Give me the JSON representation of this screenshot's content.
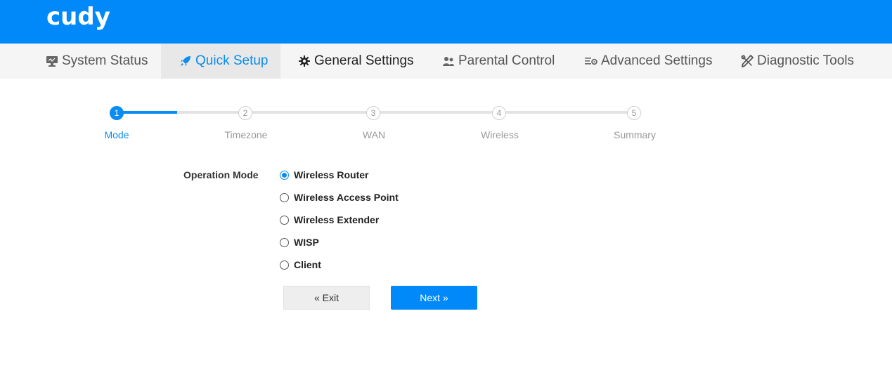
{
  "header": {
    "logo": "cudy",
    "brand_color": "#0189fa"
  },
  "nav": {
    "tabs": [
      {
        "label": "System Status",
        "icon": "monitor-icon"
      },
      {
        "label": "Quick Setup",
        "icon": "rocket-icon",
        "active": true
      },
      {
        "label": "General Settings",
        "icon": "gear-icon"
      },
      {
        "label": "Parental Control",
        "icon": "users-icon"
      },
      {
        "label": "Advanced Settings",
        "icon": "list-gear-icon"
      },
      {
        "label": "Diagnostic Tools",
        "icon": "tools-icon"
      }
    ]
  },
  "stepper": {
    "current": 1,
    "steps": [
      {
        "num": "1",
        "label": "Mode"
      },
      {
        "num": "2",
        "label": "Timezone"
      },
      {
        "num": "3",
        "label": "WAN"
      },
      {
        "num": "4",
        "label": "Wireless"
      },
      {
        "num": "5",
        "label": "Summary"
      }
    ]
  },
  "form": {
    "label": "Operation Mode",
    "selected": "Wireless Router",
    "options": [
      "Wireless Router",
      "Wireless Access Point",
      "Wireless Extender",
      "WISP",
      "Client"
    ]
  },
  "buttons": {
    "exit": "« Exit",
    "next": "Next »"
  },
  "colors": {
    "accent": "#0a8cf0",
    "nav_bg": "#f5f5f5",
    "active_tab_bg": "#e8e8e8"
  }
}
